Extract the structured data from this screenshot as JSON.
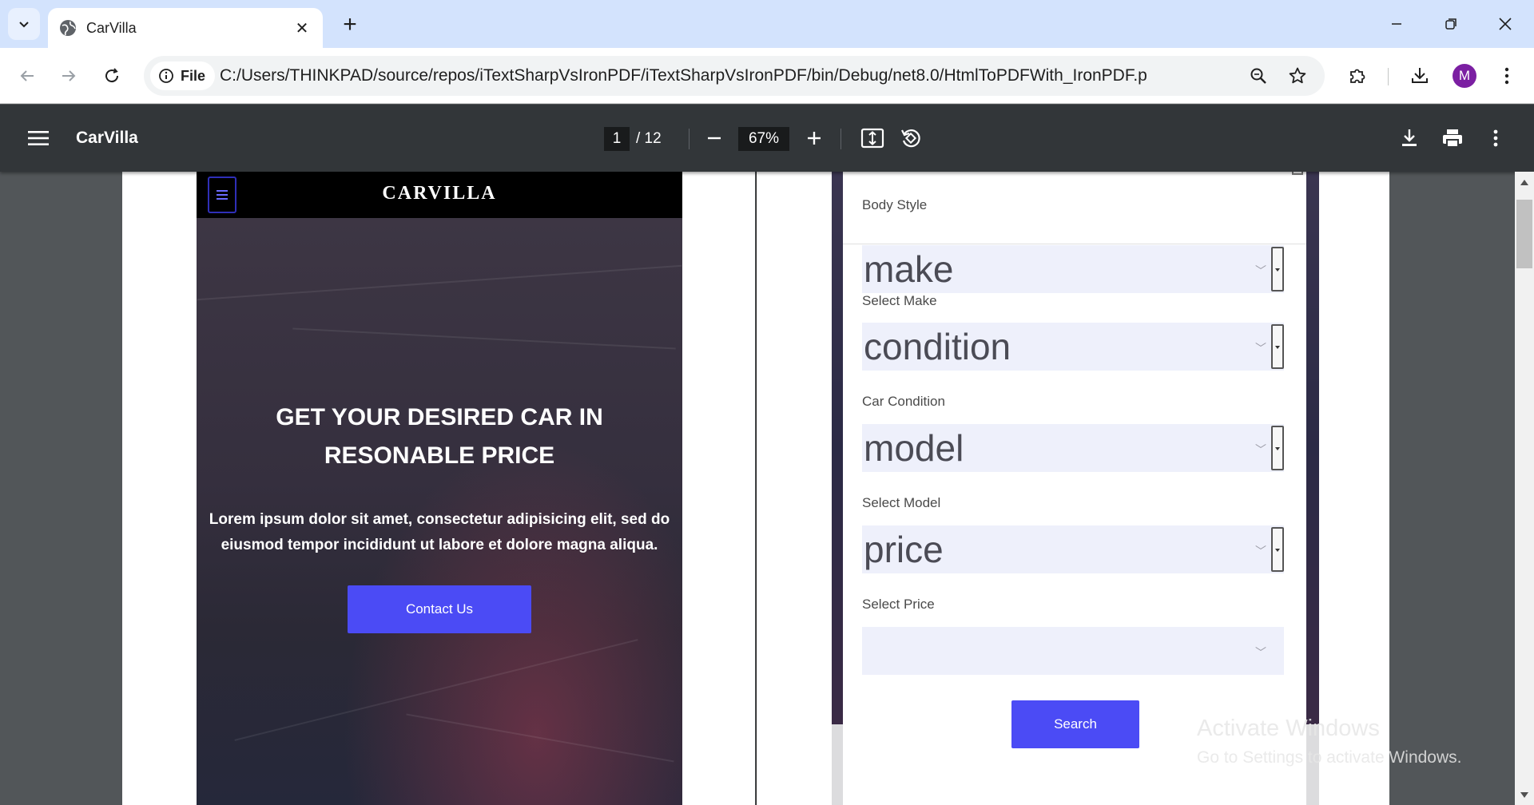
{
  "browser": {
    "tab_title": "CarVilla",
    "file_chip": "File",
    "url": "C:/Users/THINKPAD/source/repos/iTextSharpVsIronPDF/iTextSharpVsIronPDF/bin/Debug/net8.0/HtmlToPDFWith_IronPDF.pdf",
    "profile_initial": "M"
  },
  "pdf_toolbar": {
    "title": "CarVilla",
    "current_page": "1",
    "total_pages": "/ 12",
    "zoom": "67%"
  },
  "page1": {
    "brand": "CARVILLA",
    "hero_heading": "GET YOUR DESIRED CAR IN RESONABLE PRICE",
    "hero_text": "Lorem ipsum dolor sit amet, consectetur adipisicing elit, sed do eiusmod tempor incididunt ut labore et dolore magna aliqua.",
    "contact_button": "Contact Us"
  },
  "page2": {
    "body_style_label": "Body Style",
    "make_value": "make",
    "make_label": "Select Make",
    "condition_value": "condition",
    "condition_label": "Car Condition",
    "model_value": "model",
    "model_label": "Select Model",
    "price_value": "price",
    "price_label": "Select Price",
    "search_button": "Search"
  },
  "watermark": {
    "line1": "Activate Windows",
    "line2": "Go to Settings to activate Windows."
  },
  "icons": {
    "tab_search": "chevron-down-icon",
    "favicon": "globe-icon",
    "tab_close": "close-icon",
    "new_tab": "plus-icon",
    "back": "arrow-left-icon",
    "forward": "arrow-right-icon",
    "reload": "reload-icon",
    "site_info": "info-icon",
    "zoom": "magnifier-icon",
    "bookmark": "star-icon",
    "extensions": "puzzle-icon",
    "downloads": "download-icon",
    "menu": "kebab-icon"
  },
  "colors": {
    "accent_button": "#4b4bf5",
    "pdf_toolbar": "#323639",
    "tabstrip": "#d3e3fd"
  }
}
